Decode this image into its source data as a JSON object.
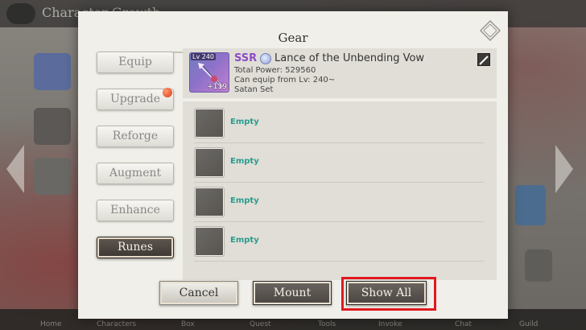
{
  "background": {
    "title": "Character Growth",
    "bottom_nav": [
      "Home",
      "Characters",
      "Box",
      "Quest",
      "Tools",
      "Invoke",
      "Chat",
      "Guild"
    ]
  },
  "modal": {
    "title": "Gear",
    "menu": [
      {
        "label": "Equip",
        "active": false,
        "badge": false
      },
      {
        "label": "Upgrade",
        "active": false,
        "badge": true
      },
      {
        "label": "Reforge",
        "active": false,
        "badge": false
      },
      {
        "label": "Augment",
        "active": false,
        "badge": false
      },
      {
        "label": "Enhance",
        "active": false,
        "badge": false
      },
      {
        "label": "Runes",
        "active": true,
        "badge": false
      }
    ],
    "item": {
      "level": "Lv 240",
      "enhance": "+119",
      "rarity": "SSR",
      "name": "Lance of the Unbending Vow",
      "total_power": "Total Power: 529560",
      "equip_from": "Can equip from Lv: 240~",
      "set": "Satan Set"
    },
    "slots": [
      {
        "label": "Empty"
      },
      {
        "label": "Empty"
      },
      {
        "label": "Empty"
      },
      {
        "label": "Empty"
      }
    ],
    "buttons": {
      "cancel": "Cancel",
      "mount": "Mount",
      "show_all": "Show All"
    }
  },
  "colors": {
    "rarity": "#8d4cc7",
    "slot_text": "#2a9b8d",
    "highlight": "#e0191f"
  }
}
